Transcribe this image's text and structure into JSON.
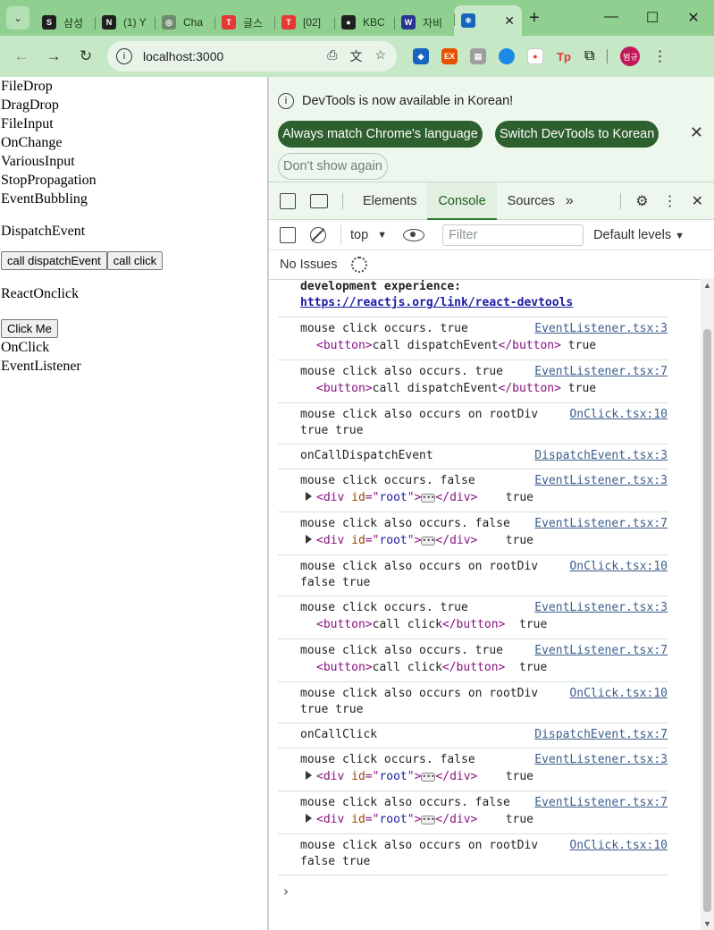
{
  "tabs": [
    {
      "label": "삼성",
      "fav_color": "#1f1f1f",
      "fav_glyph": "S"
    },
    {
      "label": "(1) Y",
      "fav_color": "#1f1f1f",
      "fav_glyph": "N"
    },
    {
      "label": "Cha",
      "fav_color": "#6c8a6c",
      "fav_glyph": "◎"
    },
    {
      "label": "글스",
      "fav_color": "#e53935",
      "fav_glyph": "T"
    },
    {
      "label": "[02]",
      "fav_color": "#e53935",
      "fav_glyph": "T"
    },
    {
      "label": "KBC",
      "fav_color": "#1f1f1f",
      "fav_glyph": "●"
    },
    {
      "label": "자비",
      "fav_color": "#283593",
      "fav_glyph": "W"
    },
    {
      "label": "",
      "fav_color": "#1565c0",
      "fav_glyph": "⚛",
      "active": true
    }
  ],
  "address": {
    "url": "localhost:3000"
  },
  "page": {
    "links": [
      "FileDrop",
      "DragDrop",
      "FileInput",
      "OnChange",
      "VariousInput",
      "StopPropagation",
      "EventBubbling"
    ],
    "dispatch_title": "DispatchEvent",
    "btn_dispatch": "call dispatchEvent",
    "btn_click": "call click",
    "react_title": "ReactOnclick",
    "btn_clickme": "Click Me",
    "onclick": "OnClick",
    "eventlistener": "EventListener"
  },
  "devtools": {
    "info_text": "DevTools is now available in Korean!",
    "btn_always": "Always match Chrome's language",
    "btn_switch": "Switch DevTools to Korean",
    "btn_dont": "Don't show again",
    "tab_elements": "Elements",
    "tab_console": "Console",
    "tab_sources": "Sources",
    "context": "top",
    "filter_placeholder": "Filter",
    "levels": "Default levels",
    "no_issues": "No Issues",
    "top_msg_1": "development experience:",
    "top_msg_link": "https://reactjs.org/link/react-devtools"
  },
  "logs": [
    {
      "msg": "mouse click occurs. true",
      "src": "EventListener.tsx:3",
      "sub": "button",
      "sub_text": "call dispatchEvent",
      "tail": " true"
    },
    {
      "msg": "mouse click also occurs. true",
      "src": "EventListener.tsx:7",
      "sub": "button",
      "sub_text": "call dispatchEvent",
      "tail": " true"
    },
    {
      "msg": "mouse click also occurs on rootDiv",
      "src": "OnClick.tsx:10",
      "plain": "true true"
    },
    {
      "msg": "onCallDispatchEvent",
      "src": "DispatchEvent.tsx:3"
    },
    {
      "msg": "mouse click occurs. false",
      "src": "EventListener.tsx:3",
      "sub": "div",
      "tail": "    true"
    },
    {
      "msg": "mouse click also occurs. false",
      "src": "EventListener.tsx:7",
      "sub": "div",
      "tail": "    true"
    },
    {
      "msg": "mouse click also occurs on rootDiv",
      "src": "OnClick.tsx:10",
      "plain": "false true"
    },
    {
      "msg": "mouse click occurs. true",
      "src": "EventListener.tsx:3",
      "sub": "button",
      "sub_text": "call click",
      "tail": "  true"
    },
    {
      "msg": "mouse click also occurs. true",
      "src": "EventListener.tsx:7",
      "sub": "button",
      "sub_text": "call click",
      "tail": "  true"
    },
    {
      "msg": "mouse click also occurs on rootDiv",
      "src": "OnClick.tsx:10",
      "plain": "true true"
    },
    {
      "msg": "onCallClick",
      "src": "DispatchEvent.tsx:7"
    },
    {
      "msg": "mouse click occurs. false",
      "src": "EventListener.tsx:3",
      "sub": "div",
      "tail": "    true"
    },
    {
      "msg": "mouse click also occurs. false",
      "src": "EventListener.tsx:7",
      "sub": "div",
      "tail": "    true"
    },
    {
      "msg": "mouse click also occurs on rootDiv",
      "src": "OnClick.tsx:10",
      "plain": "false true"
    }
  ],
  "colors": {
    "chrome_green": "#8fcf8f",
    "devtools_accent": "#2e5f2e",
    "link_blue": "#3b5e8b"
  }
}
